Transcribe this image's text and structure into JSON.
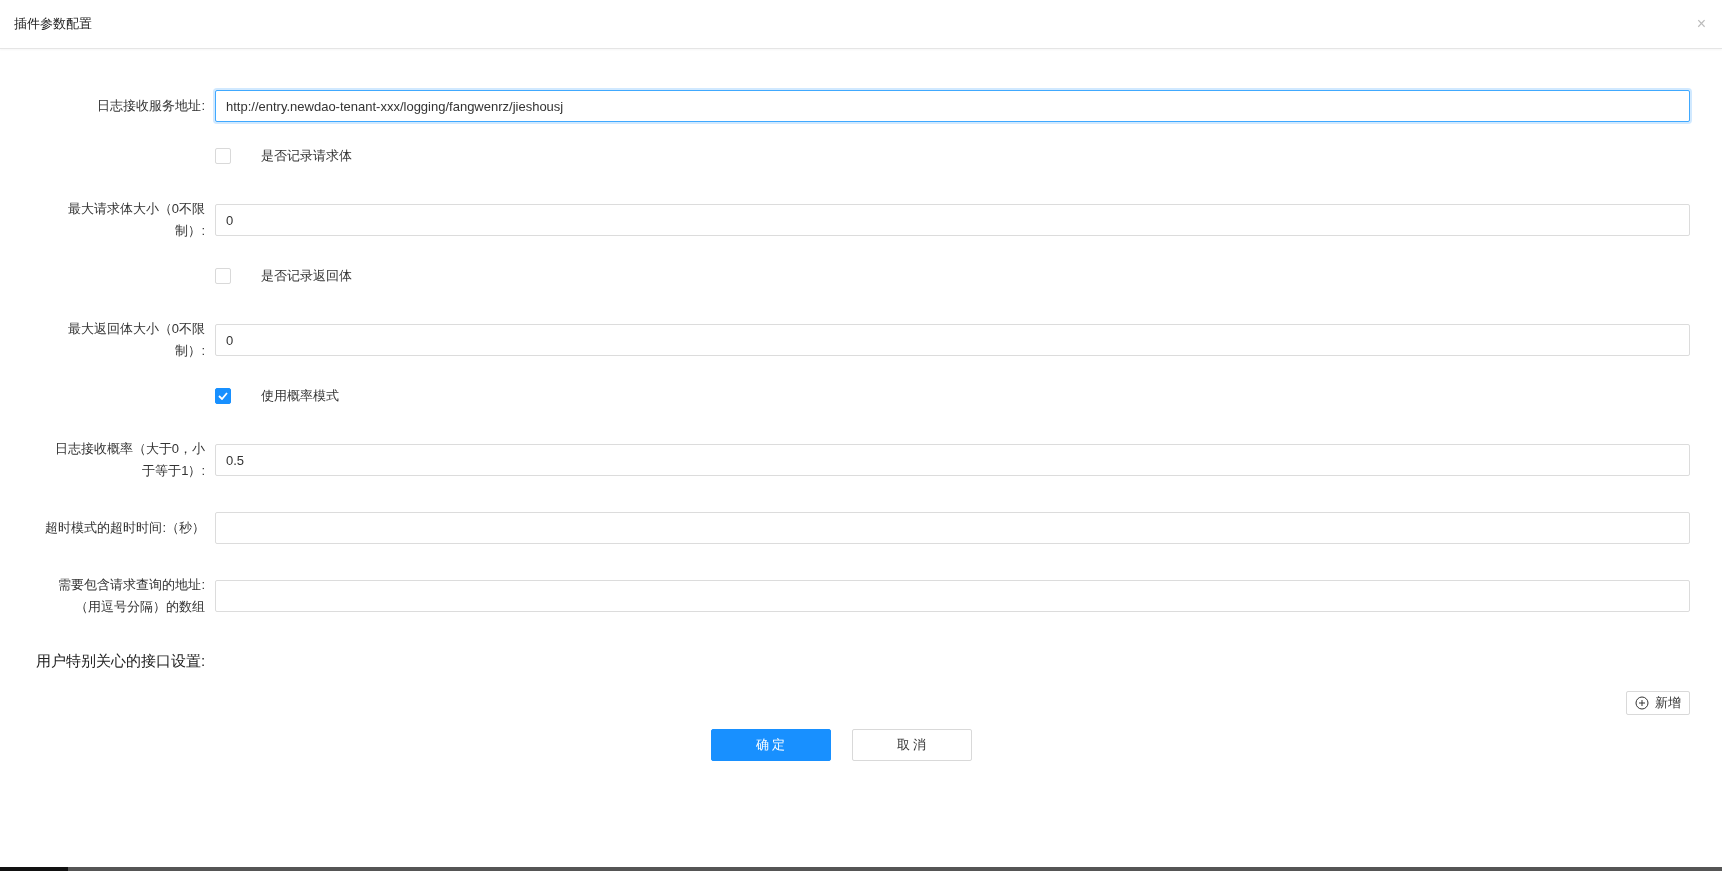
{
  "dialog": {
    "title": "插件参数配置",
    "close": "×"
  },
  "fields": [
    {
      "kind": "input",
      "label": "日志接收服务地址:",
      "value": "http://entry.newdao-tenant-xxx/logging/fangwenrz/jieshousj",
      "focused": true
    },
    {
      "kind": "checkbox",
      "label": "是否记录请求体",
      "checked": false
    },
    {
      "kind": "input",
      "label": "最大请求体大小（0不限制）:",
      "value": "0",
      "focused": false
    },
    {
      "kind": "checkbox",
      "label": "是否记录返回体",
      "checked": false
    },
    {
      "kind": "input",
      "label": "最大返回体大小（0不限制）:",
      "value": "0",
      "focused": false
    },
    {
      "kind": "checkbox",
      "label": "使用概率模式",
      "checked": true
    },
    {
      "kind": "input",
      "label": "日志接收概率（大于0，小于等于1）:",
      "value": "0.5",
      "focused": false
    },
    {
      "kind": "input",
      "label": "超时模式的超时时间:（秒）",
      "focused": false
    },
    {
      "kind": "input",
      "label": "需要包含请求查询的地址:（用逗号分隔）的数组",
      "focused": false
    }
  ],
  "section": {
    "title": "用户特别关心的接口设置:",
    "add_button": "新增"
  },
  "buttons": [
    {
      "label": "确 定",
      "primary": true
    },
    {
      "label": "取 消",
      "primary": false
    }
  ]
}
